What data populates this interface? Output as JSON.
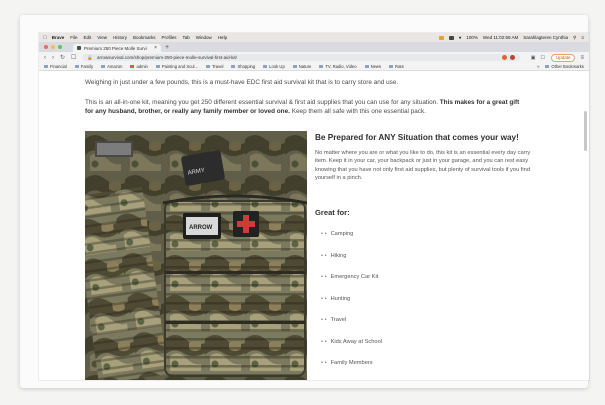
{
  "menubar": {
    "app": "Brave",
    "items": [
      "File",
      "Edit",
      "View",
      "History",
      "Bookmarks",
      "Profiles",
      "Tab",
      "Window",
      "Help"
    ],
    "status_pct": "100%",
    "clock": "Wed 11:02:59 AM",
    "user": "Sarahlagteren Cynthia"
  },
  "tab": {
    "title": "Premium 250 Piece Molle Survi... ×",
    "title_short": "Premium 250 Piece Molle Survi"
  },
  "toolbar": {
    "url": "arrowsurvival.com/shop/premium-250-piece-molle-survival-first-aid-kit/",
    "update_label": "Update"
  },
  "bookmarks": {
    "items": [
      "Financial",
      "Family",
      "Amazon",
      "admin",
      "Painting and Scul...",
      "Travel",
      "Shopping",
      "Look Up",
      "Nature",
      "TV, Radio, Video",
      "News",
      "Rate"
    ],
    "other": "Other Bookmarks"
  },
  "page": {
    "intro": "Weighing in just under a few pounds, this is a must-have EDC first aid survival kit that is to carry store and use.",
    "para2_normal": "This is an all-in-one kit, meaning you get 250 different essential survival & first aid supplies that you can use for any situation. ",
    "para2_bold": "This makes for a great gift for any husband, brother, or really any family member or loved one.",
    "para2_end": " Keep them all safe with this one essential pack.",
    "heading": "Be Prepared for ANY Situation that comes your way!",
    "body": "No matter where you are or what you like to do, this kit is an essential every day carry item. Keep it in your car, your backpack or just in your garage, and you can rest easy knowing that you have not only first aid supplies, but plenty of survival tools if you find yourself in a pinch.",
    "great_for": "Great for:",
    "uses": [
      "Camping",
      "Hiking",
      "Emergency Car Kit",
      "Hunting",
      "Travel",
      "Kids Away at School",
      "Family Members"
    ]
  },
  "colors": {
    "update_accent": "#c2552a",
    "camo_base": "#6b6a52",
    "patch_red": "#d23a3a"
  }
}
